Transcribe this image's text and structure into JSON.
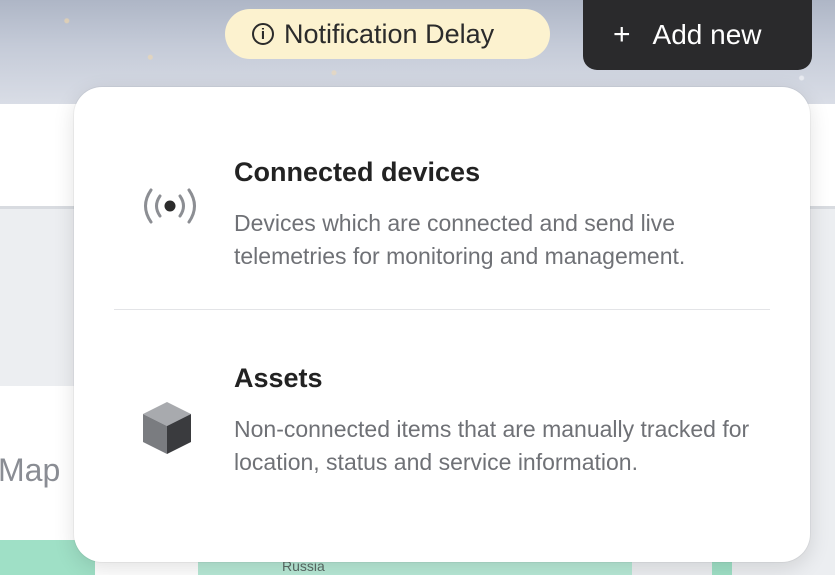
{
  "header": {
    "notification_label": "Notification Delay",
    "info_glyph": "i",
    "add_plus": "+",
    "add_label": "Add new"
  },
  "background": {
    "map_label": "Map",
    "map_country": "Russia"
  },
  "menu": {
    "items": [
      {
        "icon": "broadcast-signal-icon",
        "title": "Connected devices",
        "description": "Devices which are connected and send live telemetries for monitoring and management."
      },
      {
        "icon": "cube-icon",
        "title": "Assets",
        "description": "Non-connected items that are manually tracked for location, status and service information."
      }
    ]
  },
  "colors": {
    "accent_dark": "#2a2a2c",
    "notification_bg": "#fcf2cf",
    "map_green": "#9fe0c6"
  }
}
